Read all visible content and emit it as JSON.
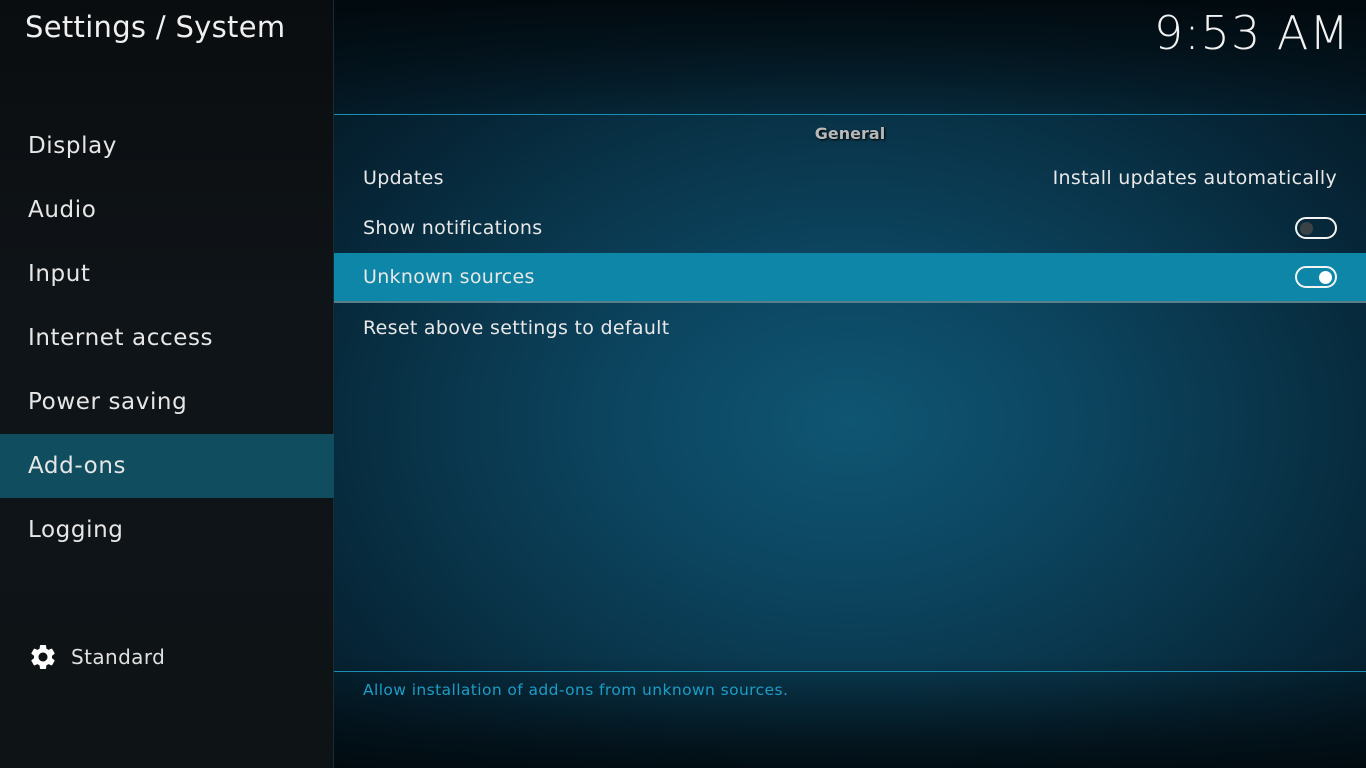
{
  "header": {
    "title": "Settings / System",
    "clock": "9:53 AM"
  },
  "sidebar": {
    "items": [
      {
        "label": "Display",
        "active": false
      },
      {
        "label": "Audio",
        "active": false
      },
      {
        "label": "Input",
        "active": false
      },
      {
        "label": "Internet access",
        "active": false
      },
      {
        "label": "Power saving",
        "active": false
      },
      {
        "label": "Add-ons",
        "active": true
      },
      {
        "label": "Logging",
        "active": false
      }
    ],
    "settings_level": {
      "icon": "gear-icon",
      "label": "Standard"
    }
  },
  "main": {
    "section_title": "General",
    "rows": [
      {
        "label": "Updates",
        "type": "value",
        "value": "Install updates automatically",
        "focused": false
      },
      {
        "label": "Show notifications",
        "type": "toggle",
        "enabled": false,
        "focused": false
      },
      {
        "label": "Unknown sources",
        "type": "toggle",
        "enabled": true,
        "focused": true
      },
      {
        "label": "Reset above settings to default",
        "type": "action",
        "focused": false
      }
    ],
    "description": "Allow installation of add-ons from unknown sources."
  },
  "colors": {
    "accent": "#0e86a7",
    "sidebar_active": "#0f4d5f",
    "description_text": "#1c9dc6",
    "divider": "#1a8fb5"
  }
}
